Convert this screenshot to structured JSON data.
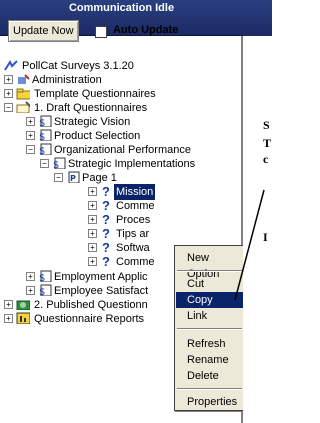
{
  "header": {
    "title": "Communication Idle"
  },
  "toolbar": {
    "update_now": "Update Now",
    "auto_update": "Auto Update"
  },
  "tree": {
    "root": "PollCat Surveys 3.1.20",
    "items": [
      "Administration",
      "Template Questionnaires",
      "1. Draft Questionnaires",
      "Strategic Vision",
      "Product Selection",
      "Organizational Performance",
      "Strategic Implementations",
      "Page 1",
      "Mission",
      "Comme",
      "Proces",
      "Tips ar",
      "Softwa",
      "Comme",
      "Employment Applic",
      "Employee Satisfact",
      "2. Published Questionn",
      "Questionnaire Reports"
    ]
  },
  "context_menu": {
    "items": [
      "New Option",
      "Cut",
      "Copy",
      "Link",
      "Refresh",
      "Rename",
      "Delete",
      "Properties"
    ],
    "active": "Copy"
  },
  "right_fragment": {
    "lines": [
      "S",
      "T",
      "c",
      "I"
    ]
  }
}
